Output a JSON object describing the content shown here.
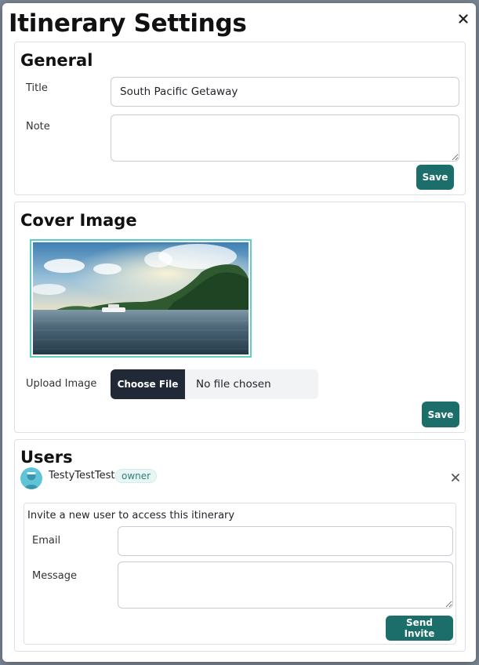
{
  "modal": {
    "title": "Itinerary Settings",
    "close_icon": "close-icon"
  },
  "general": {
    "heading": "General",
    "title_label": "Title",
    "title_value": "South Pacific Getaway",
    "note_label": "Note",
    "note_value": "",
    "save_label": "Save"
  },
  "cover": {
    "heading": "Cover Image",
    "upload_label": "Upload Image",
    "choose_file_label": "Choose File",
    "file_status": "No file chosen",
    "save_label": "Save"
  },
  "users": {
    "heading": "Users",
    "list": [
      {
        "name": "TestyTestTest",
        "role": "owner"
      }
    ],
    "invite": {
      "prompt": "Invite a new user to access this itinerary",
      "email_label": "Email",
      "email_value": "",
      "message_label": "Message",
      "message_value": "",
      "send_label": "Send Invite"
    }
  },
  "colors": {
    "accent": "#1b6e69",
    "file_button": "#212936",
    "image_border": "#5ccfc2"
  }
}
